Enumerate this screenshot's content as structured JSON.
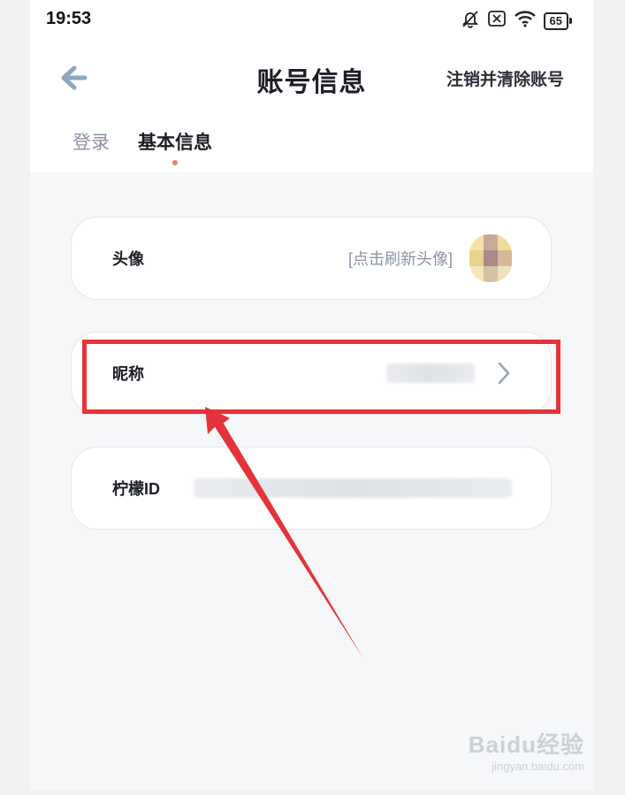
{
  "status_bar": {
    "time": "19:53",
    "battery_level": "65",
    "icons": [
      "bell-off-icon",
      "no-sim-icon",
      "wifi-icon",
      "battery-icon"
    ]
  },
  "nav": {
    "back_icon": "arrow-left-icon",
    "title": "账号信息",
    "action": "注销并清除账号"
  },
  "tabs": [
    {
      "label": "登录",
      "active": false
    },
    {
      "label": "基本信息",
      "active": true
    }
  ],
  "rows": {
    "avatar": {
      "label": "头像",
      "action_text": "[点击刷新头像]"
    },
    "nickname": {
      "label": "昵称",
      "value": "",
      "chevron_icon": "chevron-right-icon"
    },
    "lemon_id": {
      "label": "柠檬ID",
      "value": ""
    }
  },
  "annotation": {
    "highlight_color": "#e5333b",
    "target": "nickname-row"
  },
  "watermark": {
    "brand": "Baidu经验",
    "url": "jingyan.baidu.com"
  },
  "colors": {
    "accent_back": "#8ea7bf",
    "muted_text": "#8a94a6",
    "tab_dot": "#f07c72",
    "highlight": "#e5333b"
  }
}
